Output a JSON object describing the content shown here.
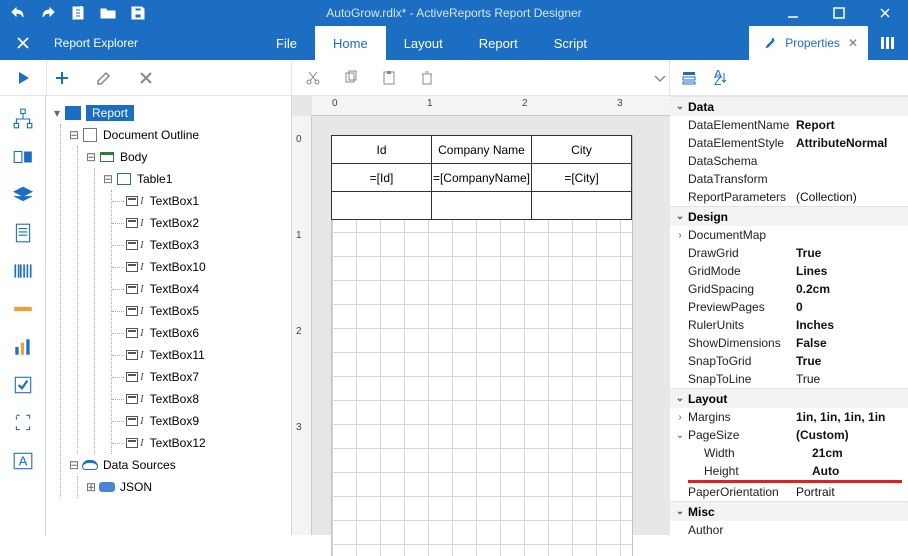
{
  "title": "AutoGrow.rdlx* - ActiveReports Report Designer",
  "explorer_title": "Report Explorer",
  "menu": {
    "file": "File",
    "home": "Home",
    "layout": "Layout",
    "report": "Report",
    "script": "Script"
  },
  "properties_tab": "Properties",
  "tree": {
    "root": "Report",
    "doc_outline": "Document Outline",
    "body": "Body",
    "table": "Table1",
    "textboxes": [
      "TextBox1",
      "TextBox2",
      "TextBox3",
      "TextBox10",
      "TextBox4",
      "TextBox5",
      "TextBox6",
      "TextBox11",
      "TextBox7",
      "TextBox8",
      "TextBox9",
      "TextBox12"
    ],
    "data_sources": "Data Sources",
    "json_ds": "JSON"
  },
  "table_design": {
    "headers": [
      "Id",
      "Company Name",
      "City"
    ],
    "exprs": [
      "=[Id]",
      "=[CompanyName]",
      "=[City]"
    ]
  },
  "ruler": {
    "h": [
      "0",
      "1",
      "2",
      "3"
    ],
    "v": [
      "0",
      "1",
      "2",
      "3"
    ]
  },
  "props": {
    "categories": {
      "data": "Data",
      "design": "Design",
      "layout": "Layout",
      "misc": "Misc"
    },
    "data": [
      {
        "k": "DataElementName",
        "v": "Report",
        "bold": true
      },
      {
        "k": "DataElementStyle",
        "v": "AttributeNormal",
        "bold": true
      },
      {
        "k": "DataSchema",
        "v": ""
      },
      {
        "k": "DataTransform",
        "v": ""
      },
      {
        "k": "ReportParameters",
        "v": "(Collection)"
      }
    ],
    "design": [
      {
        "k": "DocumentMap",
        "v": "",
        "exp": ">"
      },
      {
        "k": "DrawGrid",
        "v": "True",
        "bold": true
      },
      {
        "k": "GridMode",
        "v": "Lines",
        "bold": true
      },
      {
        "k": "GridSpacing",
        "v": "0.2cm",
        "bold": true
      },
      {
        "k": "PreviewPages",
        "v": "0",
        "bold": true
      },
      {
        "k": "RulerUnits",
        "v": "Inches",
        "bold": true
      },
      {
        "k": "ShowDimensions",
        "v": "False",
        "bold": true
      },
      {
        "k": "SnapToGrid",
        "v": "True",
        "bold": true
      },
      {
        "k": "SnapToLine",
        "v": "True"
      }
    ],
    "layout": [
      {
        "k": "Margins",
        "v": "1in, 1in, 1in, 1in",
        "bold": true,
        "exp": ">"
      },
      {
        "k": "PageSize",
        "v": "(Custom)",
        "bold": true,
        "exp": "v"
      },
      {
        "k": "Width",
        "v": "21cm",
        "bold": true,
        "sub": true
      },
      {
        "k": "Height",
        "v": "Auto",
        "bold": true,
        "sub": true,
        "hl": true
      },
      {
        "k": "PaperOrientation",
        "v": "Portrait"
      }
    ],
    "misc": [
      {
        "k": "Author",
        "v": ""
      }
    ]
  }
}
